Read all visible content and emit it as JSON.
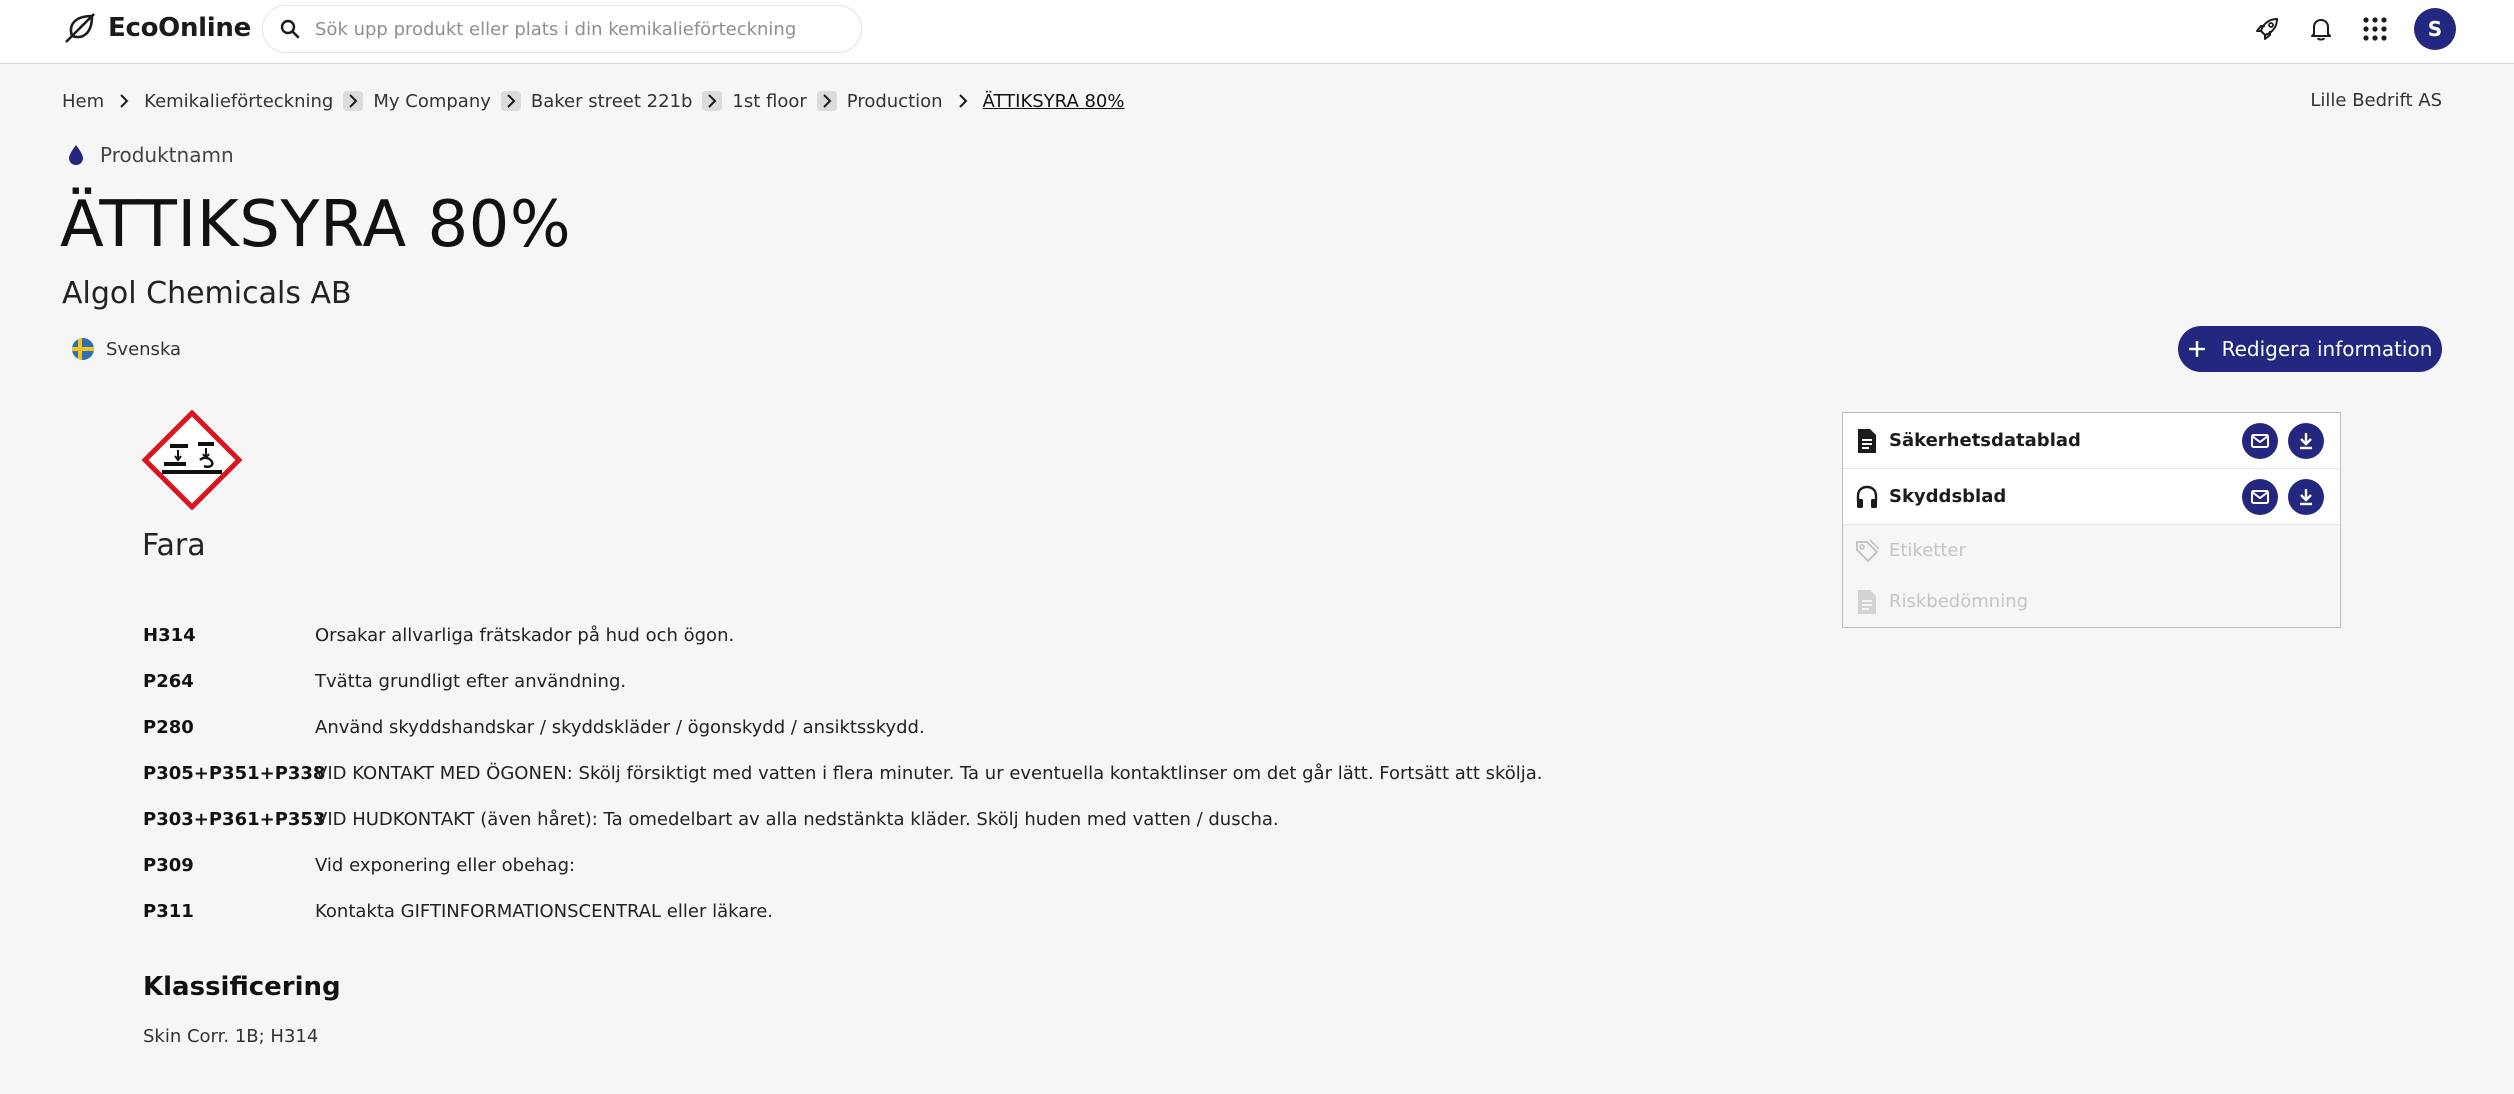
{
  "header": {
    "logo_text": "EcoOnline",
    "search_placeholder": "Sök upp produkt eller plats i din kemikalieförteckning",
    "avatar_initial": "S"
  },
  "breadcrumb": {
    "items": [
      "Hem",
      "Kemikalieförteckning",
      "My Company",
      "Baker street 221b",
      "1st floor",
      "Production",
      "ÄTTIKSYRA 80%"
    ],
    "company": "Lille Bedrift AS"
  },
  "product": {
    "label": "Produktnamn",
    "name": "ÄTTIKSYRA 80%",
    "supplier": "Algol Chemicals AB",
    "language": "Svenska",
    "edit_label": "Redigera information"
  },
  "hazard": {
    "pictogram": "corrosion-pictogram",
    "signal_word": "Fara",
    "statements": [
      {
        "code": "H314",
        "text": "Orsakar allvarliga frätskador på hud och ögon."
      },
      {
        "code": "P264",
        "text": "Tvätta grundligt efter användning."
      },
      {
        "code": "P280",
        "text": "Använd skyddshandskar / skyddskläder / ögonskydd / ansiktsskydd."
      },
      {
        "code": "P305+P351+P338",
        "text": "VID KONTAKT MED ÖGONEN: Skölj försiktigt med vatten i flera minuter. Ta ur eventuella kontaktlinser om det går lätt. Fortsätt att skölja."
      },
      {
        "code": "P303+P361+P353",
        "text": "VID HUDKONTAKT (även håret): Ta omedelbart av alla nedstänkta kläder. Skölj huden med vatten / duscha."
      },
      {
        "code": "P309",
        "text": "Vid exponering eller obehag:"
      },
      {
        "code": "P311",
        "text": "Kontakta GIFTINFORMATIONSCENTRAL eller läkare."
      }
    ],
    "classification_title": "Klassificering",
    "classification_value": "Skin Corr. 1B; H314"
  },
  "documents": [
    {
      "label": "Säkerhetsdatablad",
      "icon": "document-icon",
      "enabled": true
    },
    {
      "label": "Skyddsblad",
      "icon": "headphones-icon",
      "enabled": true
    },
    {
      "label": "Etiketter",
      "icon": "tag-icon",
      "enabled": false
    },
    {
      "label": "Riskbedömning",
      "icon": "document-icon",
      "enabled": false
    }
  ],
  "colors": {
    "primary": "#24277f",
    "hazard_red": "#d9141c",
    "background": "#f6f6f6"
  }
}
